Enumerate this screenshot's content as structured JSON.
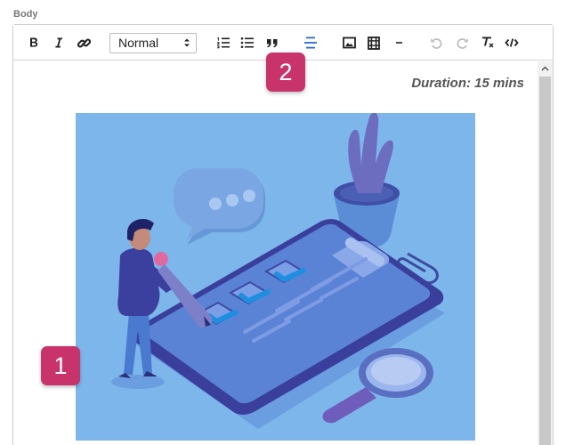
{
  "field": {
    "label": "Body"
  },
  "toolbar": {
    "format_select": {
      "value": "Normal"
    },
    "buttons": [
      {
        "icon": "bold-icon"
      },
      {
        "icon": "italic-icon"
      },
      {
        "icon": "link-icon"
      },
      {
        "icon": "ordered-list-icon"
      },
      {
        "icon": "bullet-list-icon"
      },
      {
        "icon": "blockquote-icon"
      },
      {
        "icon": "align-center-icon",
        "active": true
      },
      {
        "icon": "image-icon"
      },
      {
        "icon": "video-icon"
      },
      {
        "icon": "horizontal-rule-icon"
      },
      {
        "icon": "undo-icon",
        "disabled": true
      },
      {
        "icon": "redo-icon",
        "disabled": true
      },
      {
        "icon": "clear-format-icon"
      },
      {
        "icon": "code-view-icon"
      }
    ]
  },
  "content": {
    "duration_text": "Duration: 15 mins"
  },
  "badges": {
    "first": "1",
    "second": "2"
  },
  "colors": {
    "badge": "#c8336b",
    "illustration_bg": "#7db6ea",
    "accent": "#2a6bd1"
  }
}
